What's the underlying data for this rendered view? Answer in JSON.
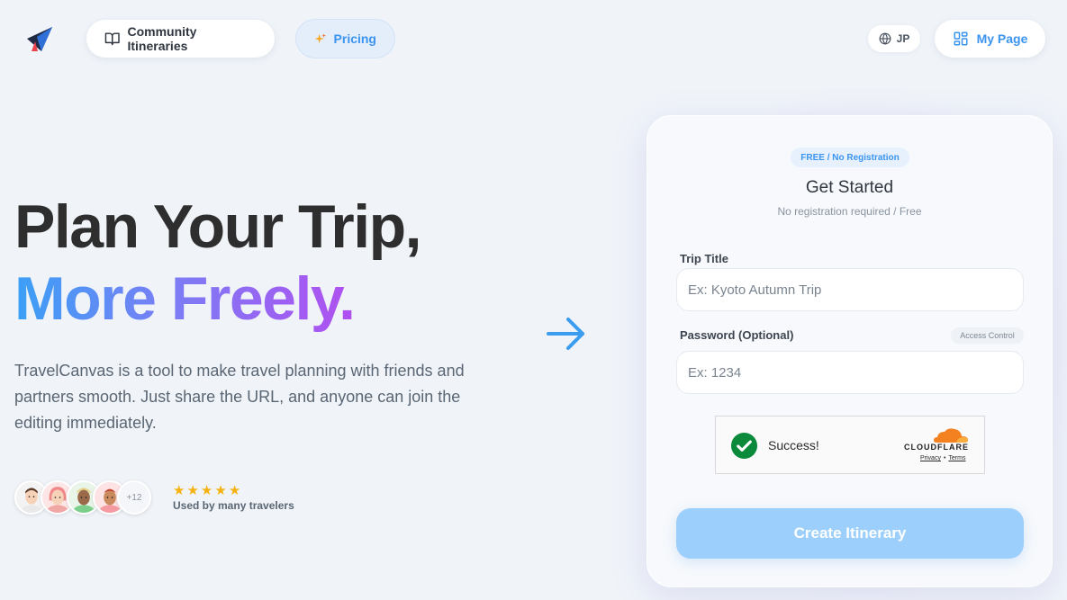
{
  "header": {
    "logo_icon": "paper-plane-icon",
    "community_label": "Community Itineraries",
    "community_icon": "book-open-icon",
    "pricing_label": "Pricing",
    "pricing_icon": "sparkles-icon",
    "language_label": "JP",
    "language_icon": "globe-icon",
    "mypage_label": "My Page",
    "mypage_icon": "grid-icon"
  },
  "hero": {
    "headline_line1": "Plan Your Trip,",
    "headline_line2": "More Freely.",
    "description": "TravelCanvas is a tool to make travel planning with friends and partners smooth. Just share the URL, and anyone can join the editing immediately.",
    "avatar_more": "+12",
    "rating_stars": 5,
    "rating_text": "Used by many travelers"
  },
  "form": {
    "badge": "FREE / No Registration",
    "title": "Get Started",
    "subtitle": "No registration required / Free",
    "trip_title_label": "Trip Title",
    "trip_title_placeholder": "Ex: Kyoto Autumn Trip",
    "trip_title_value": "",
    "password_label": "Password (Optional)",
    "access_tag": "Access Control",
    "password_placeholder": "Ex: 1234",
    "password_value": "",
    "captcha": {
      "status": "Success!",
      "brand": "CLOUDFLARE",
      "privacy": "Privacy",
      "separator": "•",
      "terms": "Terms"
    },
    "submit_label": "Create Itinerary"
  },
  "colors": {
    "accent": "#3b94ef",
    "gradient_start": "#3ba0f5",
    "gradient_end": "#b14ff0",
    "submit_disabled": "#9ccffb",
    "star": "#f5b210",
    "success_green": "#0a8a3a",
    "cloudflare_orange": "#f48120"
  }
}
